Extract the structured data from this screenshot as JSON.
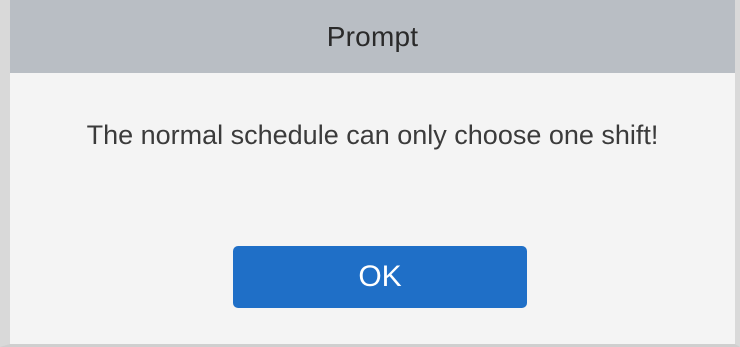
{
  "dialog": {
    "title": "Prompt",
    "message": "The normal schedule can only choose one shift!",
    "ok_label": "OK"
  },
  "colors": {
    "titlebar_bg": "#b9bec4",
    "body_bg": "#f4f4f4",
    "button_bg": "#1f6fc7",
    "button_text": "#ffffff"
  }
}
